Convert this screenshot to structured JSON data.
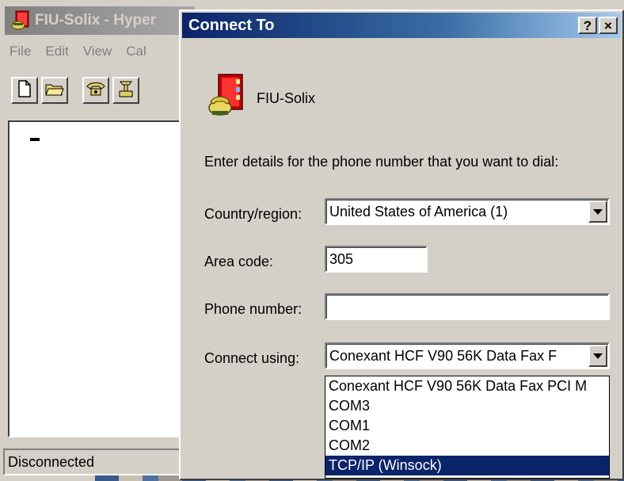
{
  "background_window": {
    "title": "FIU-Solix - Hyper",
    "menu": [
      "File",
      "Edit",
      "View",
      "Cal"
    ],
    "status": "Disconnected"
  },
  "dialog": {
    "title": "Connect To",
    "help_label": "?",
    "close_label": "×",
    "connection_name": "FIU-Solix",
    "instructions": "Enter details for the phone number that you want to dial:",
    "country_label": "Country/region:",
    "country_value": "United States of America (1)",
    "area_label": "Area code:",
    "area_value": "305",
    "phone_label": "Phone number:",
    "phone_value": "",
    "connect_label": "Connect using:",
    "connect_value": "Conexant HCF V90 56K Data Fax F",
    "connect_options": [
      "Conexant HCF V90 56K Data Fax PCI M",
      "COM3",
      "COM1",
      "COM2",
      "TCP/IP (Winsock)"
    ],
    "selected_option": "TCP/IP (Winsock)"
  },
  "colors": {
    "titlebar_active": "#0a246a",
    "titlebar_inactive": "#808080",
    "face": "#d4d0c8",
    "selection": "#0a246a"
  },
  "icons": {
    "app": "hyperterminal-phone-icon",
    "connection": "phone-book-icon"
  }
}
